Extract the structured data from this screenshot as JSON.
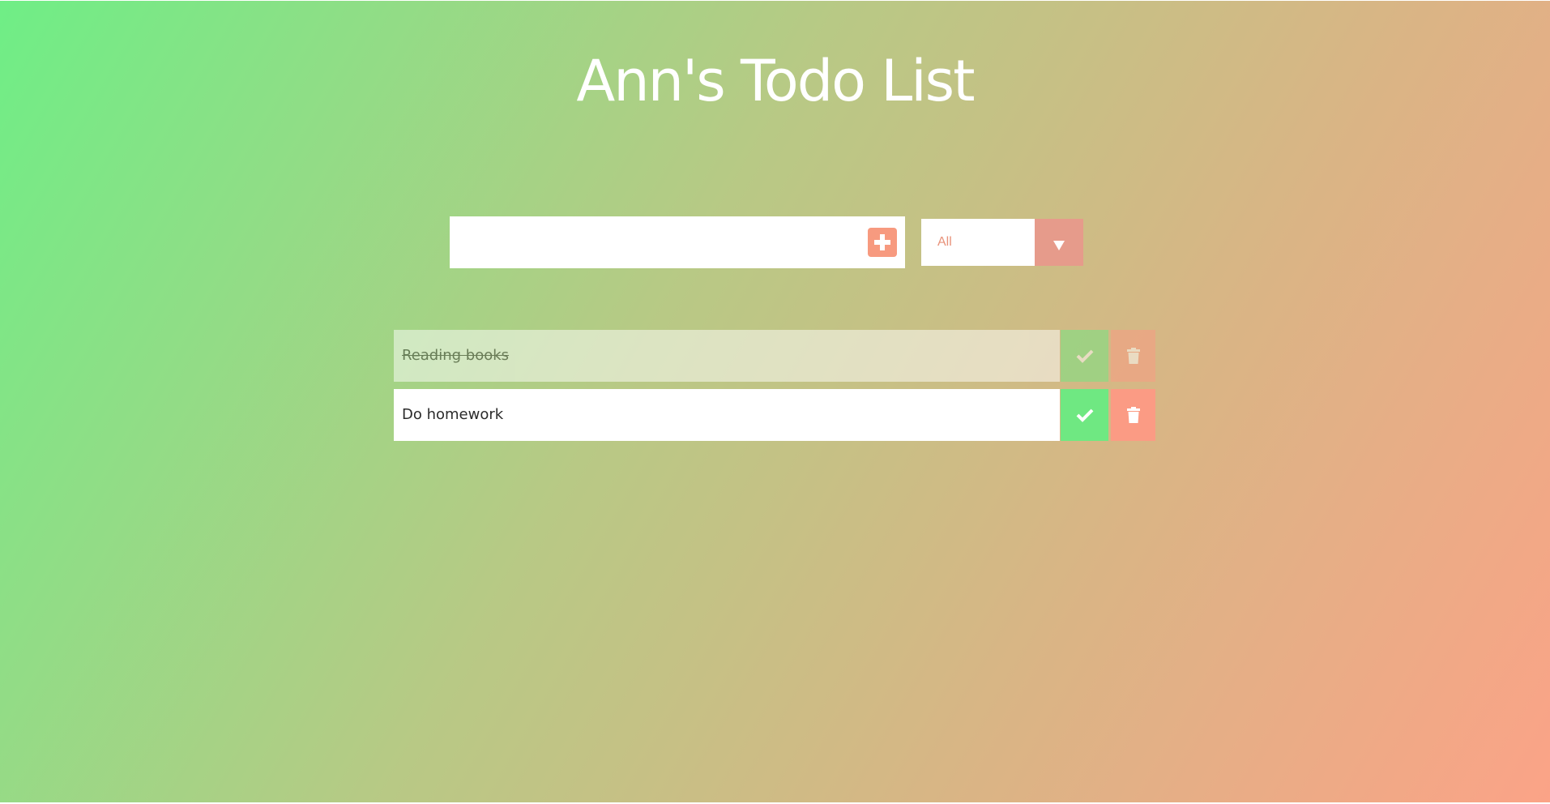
{
  "app": {
    "title": "Ann's Todo List"
  },
  "form": {
    "input_value": "",
    "add_icon": "plus-square-icon"
  },
  "filter": {
    "selected": "All",
    "arrow_icon": "caret-down-icon"
  },
  "todos": [
    {
      "text": "Reading books",
      "completed": true
    },
    {
      "text": "Do homework",
      "completed": false
    }
  ],
  "icons": {
    "complete": "check-icon",
    "delete": "trash-icon"
  },
  "colors": {
    "gradient_start": "#6fee86",
    "gradient_end": "#fba387",
    "add_button": "#f79a7f",
    "filter_arrow": "#e69b8b",
    "complete_button": "#6fe882",
    "trash_button": "#fb9b84",
    "filter_text": "#e8927a"
  }
}
